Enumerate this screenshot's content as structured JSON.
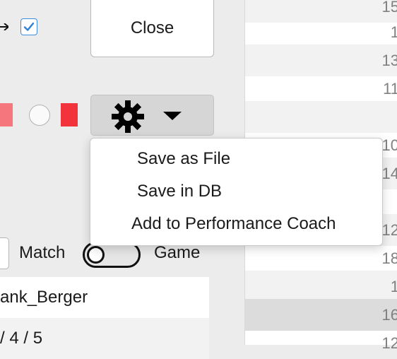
{
  "left": {
    "checkbox": {
      "checked": true
    },
    "close_button": {
      "label": "Close"
    },
    "colors": {
      "swatch_partial": "#f5777d",
      "swatch_red": "#f2333b"
    },
    "gear_button": {
      "icon": "gear-icon",
      "dropdown_icon": "caret-down-icon"
    },
    "mode": {
      "match_label": "Match",
      "game_label": "Game",
      "toggle_on": false
    },
    "list": [
      {
        "text": "ank_Berger"
      },
      {
        "text": "/ 4 / 5"
      }
    ]
  },
  "menu": {
    "items": [
      {
        "label": "Save as File"
      },
      {
        "label": "Save in DB"
      },
      {
        "label": "Add to Performance Coach"
      }
    ]
  },
  "right": {
    "rows": [
      {
        "value": "15"
      },
      {
        "value": "1"
      },
      {
        "value": "13"
      },
      {
        "value": "11"
      },
      {
        "value": ""
      },
      {
        "value": "10"
      },
      {
        "value": "14"
      },
      {
        "value": ""
      },
      {
        "value": "12"
      },
      {
        "value": "18"
      },
      {
        "value": "1"
      },
      {
        "value": "16"
      },
      {
        "value": "12"
      }
    ]
  }
}
